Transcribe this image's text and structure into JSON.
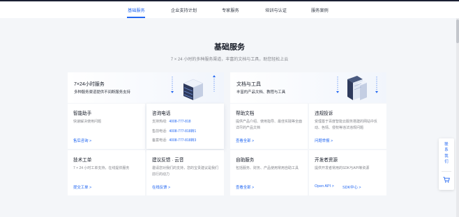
{
  "nav": {
    "tabs": [
      {
        "label": "基础服务",
        "active": true
      },
      {
        "label": "企业支持计划",
        "active": false
      },
      {
        "label": "专家服务",
        "active": false
      },
      {
        "label": "培训与认证",
        "active": false
      },
      {
        "label": "服务案例",
        "active": false
      }
    ]
  },
  "page": {
    "title": "基础服务",
    "subtitle": "7 × 24 小时的多种服务渠道，丰富的文档与工具，助您轻松上云"
  },
  "groups": {
    "left": {
      "title": "7×24小时服务",
      "subtitle": "多种服务渠道提供不间断服务支持"
    },
    "right": {
      "title": "文档与工具",
      "subtitle": "丰富的产品文档、教程与工具"
    }
  },
  "cards": {
    "assistant": {
      "title": "智能助手",
      "desc": "快速解决使用问题",
      "link": "售后咨询 >"
    },
    "consult": {
      "title": "咨询电话",
      "phones": [
        {
          "label": "支持热线:",
          "number": "4008-777-818"
        },
        {
          "label": "售前电话:",
          "number": "4008-777-818转1"
        },
        {
          "label": "备案电话:",
          "number": "4008-777-818转3"
        }
      ]
    },
    "help": {
      "title": "帮助文档",
      "desc": "提供产品介绍、使用指导、最佳实践等全面详尽的产品文档",
      "link": "查看全部 >"
    },
    "complaint": {
      "title": "违规投诉",
      "desc": "受理基于百度智能云服务搭建的网站中反动、色情、侵权等违法违规问题",
      "link": "问题举报 >"
    },
    "ticket": {
      "title": "技术工单",
      "desc": "7 × 24 小时工单支持，在线提供服务",
      "link": "提交工单 >"
    },
    "feedback": {
      "title": "建议反馈 · 云音",
      "desc": "邀请您对我们的支持，您的宝贵建议是我们前行的动力",
      "link": "在线反馈 >"
    },
    "selfservice": {
      "title": "自助服务",
      "desc": "包括服务、财务、产品使用常用自助工具",
      "link": "查看全部 >"
    },
    "developer": {
      "title": "开发者资源",
      "desc": "提供开发者常用的SDK与API等资源",
      "links": [
        "Open API >",
        "SDK中心 >"
      ]
    }
  },
  "float": {
    "contact_label": "联系我们"
  },
  "colors": {
    "accent": "#2468f2",
    "title": "#151a26",
    "muted": "#84868c",
    "background": "#f4f6f9"
  }
}
